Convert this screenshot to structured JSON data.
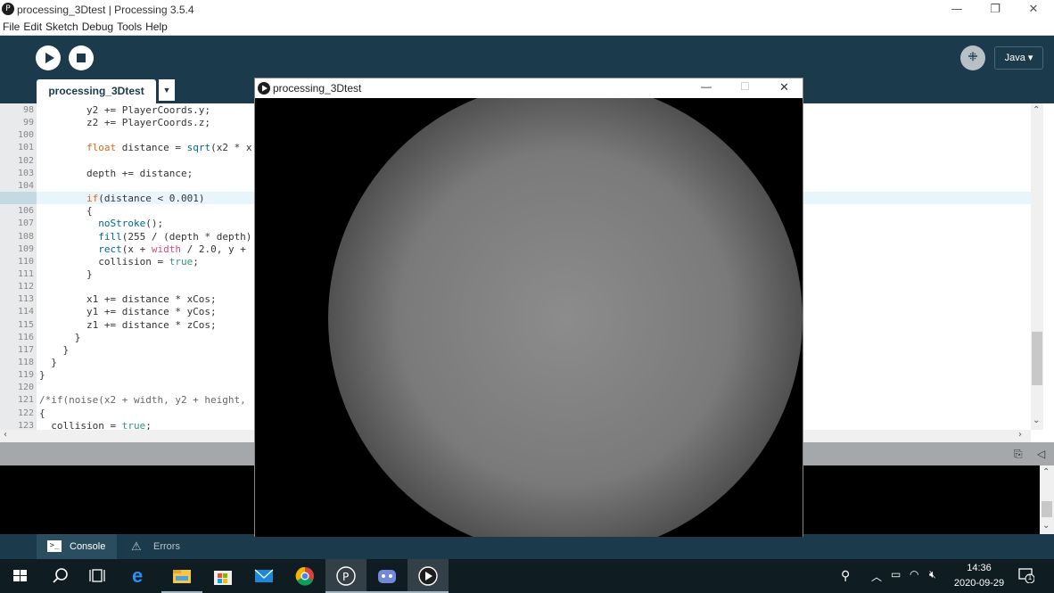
{
  "window": {
    "title": "processing_3Dtest | Processing 3.5.4",
    "app_icon": "processing-logo-icon",
    "controls": {
      "minimize": "—",
      "restore": "❐",
      "close": "✕"
    }
  },
  "menu": [
    "File",
    "Edit",
    "Sketch",
    "Debug",
    "Tools",
    "Help"
  ],
  "toolbar": {
    "run_icon": "play-icon",
    "stop_icon": "stop-icon",
    "mode_icon": "debug-butterfly-icon",
    "mode_label": "Java ▾"
  },
  "tabs": {
    "main_tab": "processing_3Dtest",
    "dropdown": "▼"
  },
  "editor": {
    "current_line": 105,
    "lines": [
      {
        "n": "98",
        "code": "        y2 += PlayerCoords.y;"
      },
      {
        "n": "99",
        "code": "        z2 += PlayerCoords.z;"
      },
      {
        "n": "100",
        "code": ""
      },
      {
        "n": "101",
        "code": "        float distance = sqrt(x2 * x"
      },
      {
        "n": "102",
        "code": ""
      },
      {
        "n": "103",
        "code": "        depth += distance;"
      },
      {
        "n": "104",
        "code": ""
      },
      {
        "n": "105",
        "code": "        if(distance < 0.001)"
      },
      {
        "n": "106",
        "code": "        {"
      },
      {
        "n": "107",
        "code": "          noStroke();"
      },
      {
        "n": "108",
        "code": "          fill(255 / (depth * depth)"
      },
      {
        "n": "109",
        "code": "          rect(x + width / 2.0, y +"
      },
      {
        "n": "110",
        "code": "          collision = true;"
      },
      {
        "n": "111",
        "code": "        }"
      },
      {
        "n": "112",
        "code": ""
      },
      {
        "n": "113",
        "code": "        x1 += distance * xCos;"
      },
      {
        "n": "114",
        "code": "        y1 += distance * yCos;"
      },
      {
        "n": "115",
        "code": "        z1 += distance * zCos;"
      },
      {
        "n": "116",
        "code": "      }"
      },
      {
        "n": "117",
        "code": "    }"
      },
      {
        "n": "118",
        "code": "  }"
      },
      {
        "n": "119",
        "code": "}"
      },
      {
        "n": "120",
        "code": ""
      },
      {
        "n": "121",
        "code": "/*if(noise(x2 + width, y2 + height,"
      },
      {
        "n": "122",
        "code": "{"
      },
      {
        "n": "123",
        "code": "  collision = true;"
      }
    ]
  },
  "console": {
    "tab_console": "Console",
    "tab_errors": "Errors"
  },
  "sketch_window": {
    "title": "processing_3Dtest",
    "controls": {
      "minimize": "—",
      "maximize": "☐",
      "close": "✕"
    }
  },
  "taskbar": {
    "time": "14:36",
    "date": "2020-09-29",
    "notification_count": "1",
    "apps": [
      "start-icon",
      "search-icon",
      "task-view-icon",
      "edge-icon",
      "file-explorer-icon",
      "store-icon",
      "mail-icon",
      "chrome-icon",
      "processing-icon",
      "discord-icon",
      "processing-sketch-icon"
    ]
  }
}
